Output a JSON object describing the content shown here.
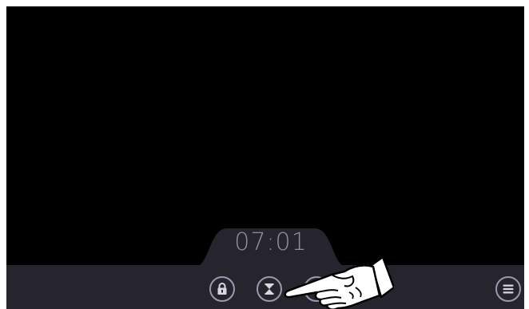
{
  "player": {
    "clock": "07:01"
  },
  "controls": [
    {
      "name": "lock",
      "icon": "lock-icon"
    },
    {
      "name": "sleep-timer",
      "icon": "hourglass-icon"
    },
    {
      "name": "hidden-control",
      "icon": "circle-icon"
    },
    {
      "name": "menu",
      "icon": "menu-icon"
    }
  ],
  "colors": {
    "screen_bg": "#000000",
    "bar_bg": "#26252e",
    "icon": "#9a9aae",
    "clock_text": "#8d8ea3"
  },
  "overlay": {
    "icon": "pointing-hand-icon"
  }
}
